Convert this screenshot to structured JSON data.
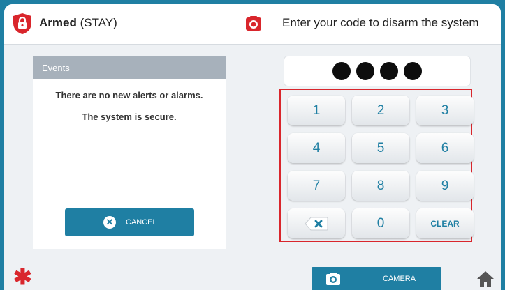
{
  "header": {
    "status_bold": "Armed",
    "status_mode": "(STAY)",
    "instruction": "Enter your code to disarm the system"
  },
  "events": {
    "title": "Events",
    "message1": "There are no new alerts or alarms.",
    "message2": "The system is secure."
  },
  "buttons": {
    "cancel_label": "CANCEL",
    "camera_label": "CAMERA"
  },
  "code": {
    "entered_digits": 4
  },
  "keypad": {
    "keys": [
      "1",
      "2",
      "3",
      "4",
      "5",
      "6",
      "7",
      "8",
      "9",
      "0"
    ],
    "clear_label": "CLEAR"
  },
  "colors": {
    "accent": "#1f7fa3",
    "alert": "#d9262c",
    "panel_header": "#a7b1bb"
  },
  "icons": {
    "status": "lock-shield-icon",
    "camera": "camera-icon",
    "backspace": "backspace-icon",
    "cancel": "close-circle-icon",
    "emergency": "asterisk-icon",
    "home": "home-icon"
  }
}
